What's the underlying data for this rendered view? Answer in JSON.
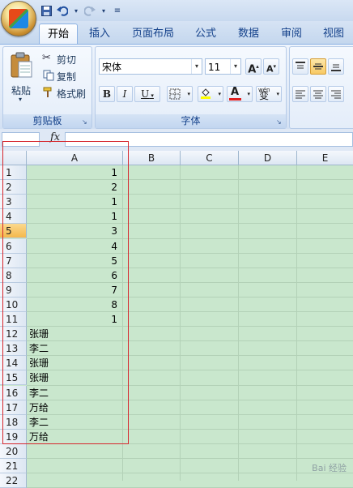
{
  "ribbon_tabs": [
    {
      "label": "开始",
      "active": true
    },
    {
      "label": "插入"
    },
    {
      "label": "页面布局"
    },
    {
      "label": "公式"
    },
    {
      "label": "数据"
    },
    {
      "label": "审阅"
    },
    {
      "label": "视图"
    }
  ],
  "clipboard": {
    "paste_label": "粘贴",
    "cut_label": "剪切",
    "copy_label": "复制",
    "format_painter_label": "格式刷",
    "group_label": "剪贴板"
  },
  "font": {
    "font_name": "宋体",
    "font_size": "11",
    "bold_label": "B",
    "italic_label": "I",
    "underline_label": "U",
    "font_color_label": "A",
    "wen_label": "变",
    "wen_top": "wén",
    "group_label": "字体"
  },
  "formula_bar": {
    "fx_label": "fx"
  },
  "sheet": {
    "columns": [
      "A",
      "B",
      "C",
      "D",
      "E"
    ],
    "rows": [
      {
        "n": "1",
        "a": "1"
      },
      {
        "n": "2",
        "a": "2"
      },
      {
        "n": "3",
        "a": "1"
      },
      {
        "n": "4",
        "a": "1"
      },
      {
        "n": "5",
        "a": "3"
      },
      {
        "n": "6",
        "a": "4"
      },
      {
        "n": "7",
        "a": "5"
      },
      {
        "n": "8",
        "a": "6"
      },
      {
        "n": "9",
        "a": "7"
      },
      {
        "n": "10",
        "a": "8"
      },
      {
        "n": "11",
        "a": "1"
      },
      {
        "n": "12",
        "a": "张珊"
      },
      {
        "n": "13",
        "a": "李二"
      },
      {
        "n": "14",
        "a": "张珊"
      },
      {
        "n": "15",
        "a": "张珊"
      },
      {
        "n": "16",
        "a": "李二"
      },
      {
        "n": "17",
        "a": "万给"
      },
      {
        "n": "18",
        "a": "李二"
      },
      {
        "n": "19",
        "a": "万给"
      },
      {
        "n": "20",
        "a": ""
      },
      {
        "n": "21",
        "a": ""
      },
      {
        "n": "22",
        "a": ""
      }
    ],
    "selected_row": "5",
    "accent_color": "#d6262d"
  },
  "watermark": "Bai 经验"
}
